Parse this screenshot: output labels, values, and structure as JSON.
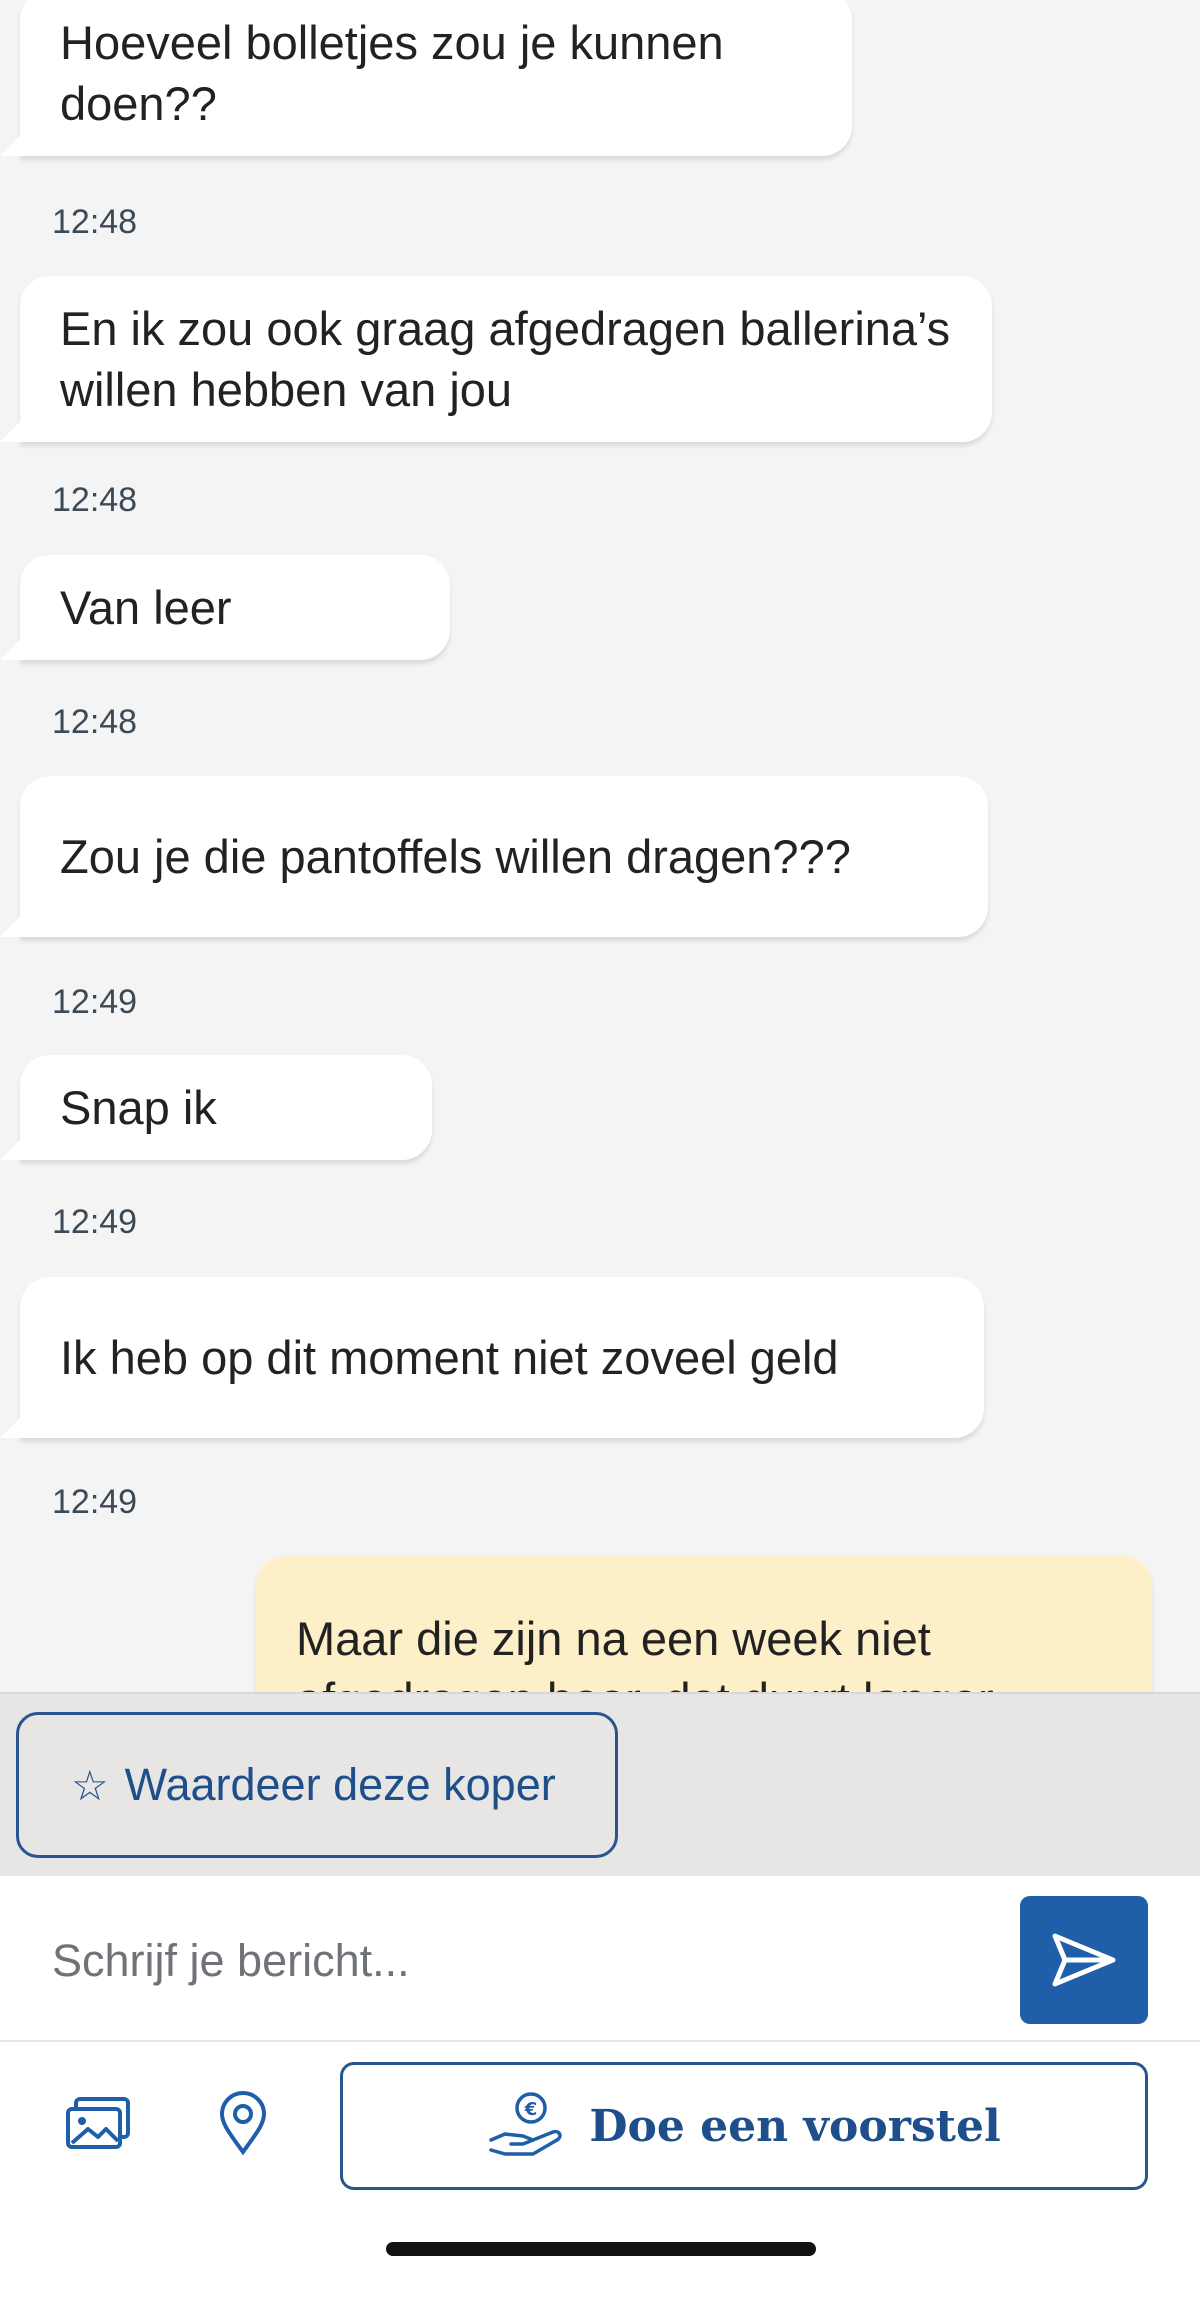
{
  "messages": [
    {
      "text": "Hoeveel bolletjes zou je kunnen doen??",
      "time": "12:48"
    },
    {
      "text": "En ik zou ook graag afgedragen ballerina’s willen hebben van jou",
      "time": "12:48"
    },
    {
      "text": "Van leer",
      "time": "12:48"
    },
    {
      "text": "Zou je die pantoffels willen dragen???",
      "time": "12:49"
    },
    {
      "text": "Snap ik",
      "time": "12:49"
    },
    {
      "text": "Ik heb op dit moment niet zoveel geld",
      "time": "12:49"
    }
  ],
  "outgoing": {
    "text": "Maar die zijn na een week niet afgedragen hoor, dat duurt langer"
  },
  "rate_button": {
    "icon": "star-outline-icon",
    "label": "Waardeer deze koper"
  },
  "composer": {
    "placeholder": "Schrijf je bericht...",
    "send_icon": "send-icon"
  },
  "actions": {
    "photo_icon": "photo-icon",
    "location_icon": "location-pin-icon",
    "offer_icon": "hand-euro-icon",
    "offer_label": "Doe een voorstel"
  },
  "colors": {
    "accent": "#1f5ea8",
    "outgoing_bubble": "#fdf0c8",
    "incoming_bubble": "#ffffff"
  }
}
